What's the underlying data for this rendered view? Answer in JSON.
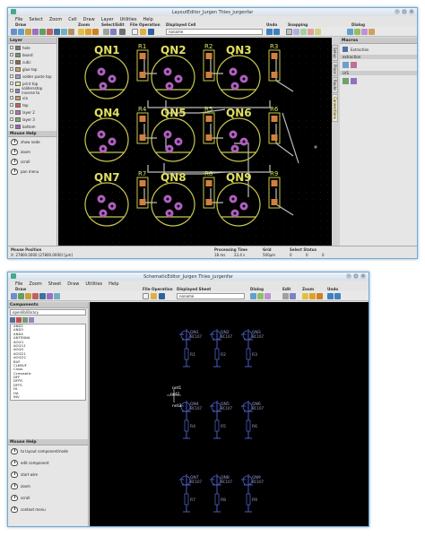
{
  "layout_window": {
    "title": "LayoutEditor_Jurgen Thies_jurgenfar",
    "menu": [
      "File",
      "Select",
      "Zoom",
      "Cell",
      "Draw",
      "Layer",
      "Utilities",
      "Help"
    ],
    "toolbar_groups": [
      "Draw",
      "Zoom",
      "Select/Edit",
      "File Operation",
      "Displayed Cell",
      "Undo",
      "Snapping",
      "Dialog"
    ],
    "displayed_cell": "noname",
    "layer_panel_title": "Layer",
    "layers": [
      {
        "name": "hole",
        "color": "#7a7a7a"
      },
      {
        "name": "board",
        "color": "#6e9a6e"
      },
      {
        "name": "cutic",
        "color": "#8a6a4a"
      },
      {
        "name": "glue top",
        "color": "#caa060"
      },
      {
        "name": "solder paste top",
        "color": "#a0a0c8"
      },
      {
        "name": "print top",
        "color": "#e8e8a0"
      },
      {
        "name": "soldersstop inverse to",
        "color": "#8a8aca"
      },
      {
        "name": "via",
        "color": "#c0a070"
      },
      {
        "name": "top",
        "color": "#c86060"
      },
      {
        "name": "layer 2",
        "color": "#b870b8"
      },
      {
        "name": "layer 3",
        "color": "#70b870"
      },
      {
        "name": "bottom",
        "color": "#a060c0"
      }
    ],
    "mouse_help_title": "Mouse Help",
    "mouse_help": [
      "show node",
      "zoom",
      "scroll",
      "pan menu"
    ],
    "components": [
      {
        "q": "QN1",
        "r": "R1"
      },
      {
        "q": "QN2",
        "r": "R2"
      },
      {
        "q": "QN3",
        "r": "R3"
      },
      {
        "q": "QN4",
        "r": "R4"
      },
      {
        "q": "QN5",
        "r": "R5"
      },
      {
        "q": "QN6",
        "r": "R6"
      },
      {
        "q": "QN7",
        "r": "R7"
      },
      {
        "q": "QN8",
        "r": "R8"
      },
      {
        "q": "QN9",
        "r": "R9"
      }
    ],
    "right_panel_title": "Macros",
    "macro_items": [
      "Extraction",
      "extraction",
      "LVS"
    ],
    "right_tabs": [
      "Setup",
      "Place",
      "Route",
      "Connections"
    ],
    "status": {
      "mouse_position_label": "Mouse Position",
      "mouse_position": "X: 27800.0000 (27800.0000) [µm]",
      "processing_time_label": "Processing Time",
      "processing_time_1": "18 ms",
      "processing_time_2": "23.4 s",
      "grid_label": "Grid",
      "grid_value": "500µm",
      "select_status_label": "Select Status",
      "select_1": "0",
      "select_2": "0",
      "select_3": "0"
    }
  },
  "schematic_window": {
    "title": "SchematicEditor_Jurgen Thies_jurgenfar",
    "menu": [
      "File",
      "Zoom",
      "Sheet",
      "Draw",
      "Utilities",
      "Help"
    ],
    "toolbar_groups": [
      "Draw",
      "File Operation",
      "Displayed Sheet",
      "Dialog",
      "Edit",
      "Zoom",
      "Undo"
    ],
    "displayed_sheet": "noname",
    "components_title": "Components",
    "library": "openlib/library",
    "component_list": [
      "AND2",
      "AND3",
      "AND4",
      "ANTENNA",
      "AOI21",
      "AOI211",
      "AOI22",
      "AOI221",
      "AOI222",
      "BUF",
      "CLKBUF",
      "Cross",
      "Ccmasetic",
      "DFF",
      "DFFR",
      "DFFS",
      "FA",
      "HA",
      "INV"
    ],
    "mouse_help_title": "Mouse Help",
    "mouse_help": [
      "to layout component/node",
      "edit component",
      "start wire",
      "zoom",
      "scroll",
      "context menu"
    ],
    "symbols": [
      {
        "q": "QN1",
        "part": "BC107",
        "r": "R1"
      },
      {
        "q": "QN2",
        "part": "BC107",
        "r": "R2"
      },
      {
        "q": "QN3",
        "part": "BC107",
        "r": "R3"
      },
      {
        "q": "QN4",
        "part": "BC107",
        "r": "R4"
      },
      {
        "q": "QN5",
        "part": "BC107",
        "r": "R5"
      },
      {
        "q": "QN6",
        "part": "BC107",
        "r": "R6"
      },
      {
        "q": "QN7",
        "part": "BC107",
        "r": "R7"
      },
      {
        "q": "QN8",
        "part": "BC107",
        "r": "R8"
      },
      {
        "q": "QN9",
        "part": "BC107",
        "r": "R9"
      }
    ],
    "net_labels": [
      "net1",
      "net2",
      "net3"
    ]
  }
}
